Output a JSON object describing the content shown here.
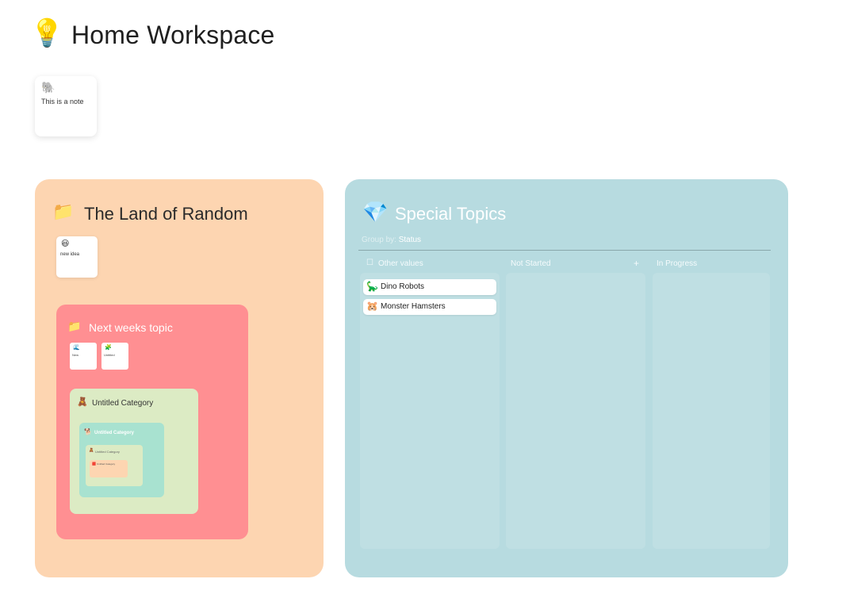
{
  "header": {
    "icon": "💡",
    "icon_name": "lightbulb-icon",
    "title": "Home Workspace"
  },
  "top_note": {
    "icon": "🐘",
    "text": "This is a note"
  },
  "categories": {
    "land_of_random": {
      "icon": "📁",
      "title": "The Land of Random",
      "color": "#fdd5b1",
      "note": {
        "icon": "😃",
        "text": "new idea"
      },
      "next_weeks": {
        "icon": "📁",
        "title": "Next weeks topic",
        "color": "#ff8f92",
        "notes": [
          {
            "icon": "🌊",
            "text": "New"
          },
          {
            "icon": "🧩",
            "text": "Untitled"
          }
        ],
        "untitled_category": {
          "icon": "🧸",
          "title": "Untitled Category",
          "color": "#dcebc4",
          "inner": {
            "icon": "🐕",
            "title": "Untitled Category",
            "color": "#a8e2d0",
            "inner": {
              "icon": "🧸",
              "title": "Untitled Category",
              "inner": {
                "icon": "🟥",
                "title": "Untitled Category"
              }
            }
          }
        }
      }
    },
    "special_topics": {
      "icon": "💎",
      "title": "Special Topics",
      "color": "#b7dbe0",
      "group_by_label": "Group by:",
      "group_by_value": "Status",
      "columns": [
        {
          "label": "Other values",
          "icon": "☐"
        },
        {
          "label": "Not Started",
          "add": "+"
        },
        {
          "label": "In Progress"
        }
      ],
      "cards": [
        {
          "icon": "🦕",
          "text": "Dino Robots"
        },
        {
          "icon": "🐹",
          "text": "Monster Hamsters"
        }
      ]
    }
  }
}
